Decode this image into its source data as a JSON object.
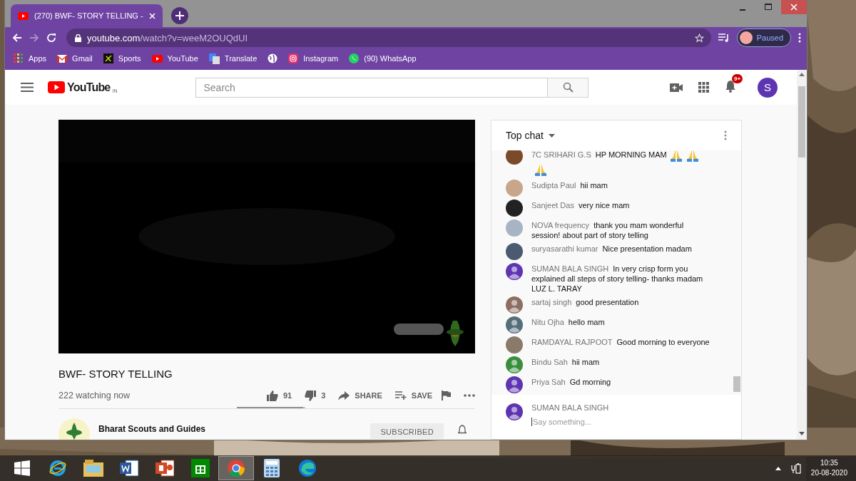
{
  "browser": {
    "tab": {
      "title": "(270) BWF- STORY TELLING -",
      "selected": true
    },
    "address": {
      "domain": "youtube.com",
      "path": "/watch?v=weeM2OUQdUI"
    },
    "profile": {
      "label": "Paused"
    },
    "bookmarks": [
      {
        "kind": "apps",
        "label": "Apps"
      },
      {
        "kind": "gmail",
        "label": "Gmail"
      },
      {
        "kind": "sports",
        "label": "Sports"
      },
      {
        "kind": "youtube",
        "label": "YouTube"
      },
      {
        "kind": "translate",
        "label": "Translate"
      },
      {
        "kind": "globe"
      },
      {
        "kind": "instagram",
        "label": "Instagram"
      },
      {
        "kind": "whatsapp",
        "label": "(90) WhatsApp"
      }
    ]
  },
  "youtube": {
    "logo": "YouTube",
    "region": "IN",
    "search": {
      "placeholder": "Search"
    },
    "notifications_badge": "9+",
    "account_initial": "S"
  },
  "video": {
    "kind": "picture",
    "title": "BWF- STORY TELLING",
    "viewers": "222 watching now",
    "likes": "91",
    "dislikes": "3",
    "share": "SHARE",
    "save": "SAVE",
    "sentiment": {
      "level": 0.97
    },
    "channel": {
      "name": "Bharat Scouts and Guides",
      "subscribe": "SUBSCRIBED"
    }
  },
  "chat": {
    "header": "Top chat",
    "messages": [
      {
        "author": "7C SRIHARI G.S",
        "text": "HP MORNING MAM",
        "emoji": [
          {
            "kind": "pray"
          },
          {
            "kind": "pray"
          },
          {
            "kind": "pray"
          }
        ],
        "color": "#7a4a2a"
      },
      {
        "author": "Sudipta Paul",
        "text": "hii mam",
        "color": "#c9a58a"
      },
      {
        "author": "Sanjeet Das",
        "text": "very nice mam",
        "color": "#222222"
      },
      {
        "author": "NOVA frequency",
        "text": "thank you mam wonderful session! about part of story telling",
        "color": "#a8b4c4"
      },
      {
        "author": "suryasarathi kumar",
        "text": "Nice presentation madam",
        "color": "#4a5a70"
      },
      {
        "author": "SUMAN BALA SINGH",
        "text": "In very crisp form you explained all steps of story telling- thanks madam LUZ L. TARAY",
        "kind": "default",
        "color": "#5e35b1"
      },
      {
        "author": "sartaj singh",
        "text": "good presentation",
        "kind": "default",
        "color": "#8d6e63"
      },
      {
        "author": "Nitu Ojha",
        "text": "hello mam",
        "kind": "default",
        "color": "#546e7a"
      },
      {
        "author": "RAMDAYAL RAJPOOT",
        "text": "Good morning to everyone",
        "color": "#8a7a6a"
      },
      {
        "author": "Bindu Sah",
        "text": "hii mam",
        "kind": "default",
        "color": "#388e3c"
      },
      {
        "author": "Priya Sah",
        "text": "Gd morning",
        "kind": "default",
        "color": "#5e35b1"
      }
    ],
    "input": {
      "author": "SUMAN BALA SINGH",
      "placeholder": "Say something...",
      "kind": "default",
      "color": "#5e35b1"
    }
  },
  "taskbar": {
    "apps": [
      {
        "kind": "ie",
        "selected": false
      },
      {
        "kind": "explorer",
        "selected": false
      },
      {
        "kind": "word",
        "selected": false
      },
      {
        "kind": "powerpoint",
        "selected": false
      },
      {
        "kind": "store",
        "selected": false
      },
      {
        "kind": "chrome",
        "selected": true
      },
      {
        "kind": "calculator",
        "selected": false
      },
      {
        "kind": "edge",
        "selected": false
      }
    ],
    "time": "10:35",
    "date": "20-08-2020"
  }
}
